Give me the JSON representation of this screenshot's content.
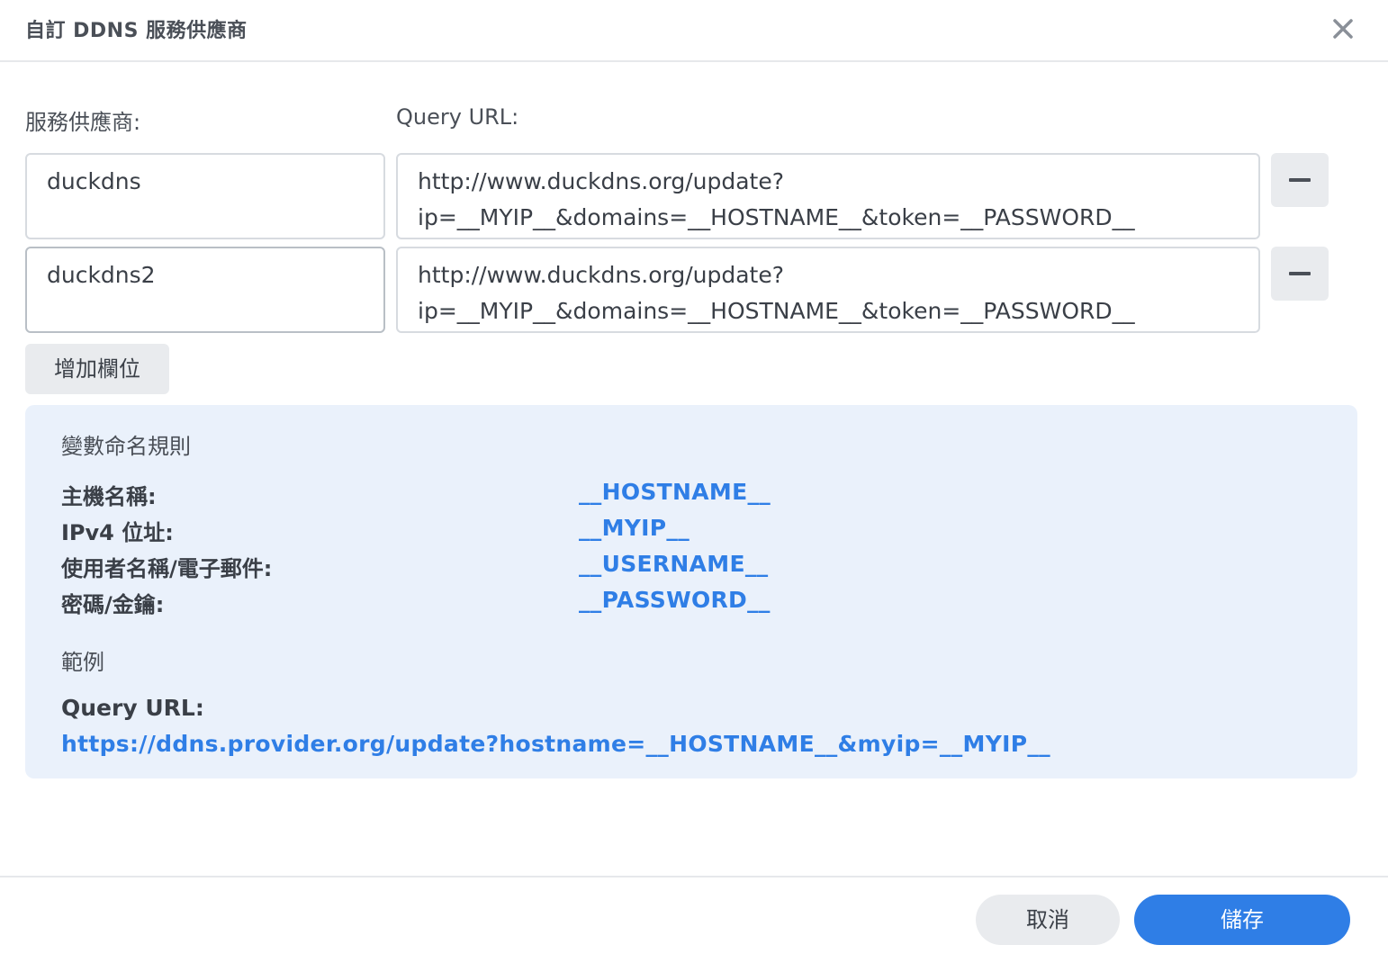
{
  "dialog": {
    "title": "自訂 DDNS 服務供應商",
    "close_icon": "close-icon"
  },
  "columns": {
    "provider_label": "服務供應商:",
    "query_url_label": "Query URL:"
  },
  "rows": [
    {
      "provider": "duckdns",
      "url_line1": "http://www.duckdns.org/update?",
      "url_line2": "ip=__MYIP__&domains=__HOSTNAME__&token=__PASSWORD__"
    },
    {
      "provider": "duckdns2",
      "url_line1": "http://www.duckdns.org/update?",
      "url_line2": "ip=__MYIP__&domains=__HOSTNAME__&token=__PASSWORD__"
    }
  ],
  "add_field_label": "增加欄位",
  "info": {
    "title": "變數命名規則",
    "rules": [
      {
        "label": "主機名稱:",
        "value": "__HOSTNAME__"
      },
      {
        "label": "IPv4 位址:",
        "value": "__MYIP__"
      },
      {
        "label": "使用者名稱/電子郵件:",
        "value": "__USERNAME__"
      },
      {
        "label": "密碼/金鑰:",
        "value": "__PASSWORD__"
      }
    ],
    "example_title": "範例",
    "example_label": "Query URL:",
    "example_url": "https://ddns.provider.org/update?hostname=__HOSTNAME__&myip=__MYIP__"
  },
  "footer": {
    "cancel_label": "取消",
    "save_label": "儲存"
  },
  "colors": {
    "accent": "#2f7ee6",
    "info_bg": "#eaf1fb",
    "button_gray": "#e9ebee"
  }
}
